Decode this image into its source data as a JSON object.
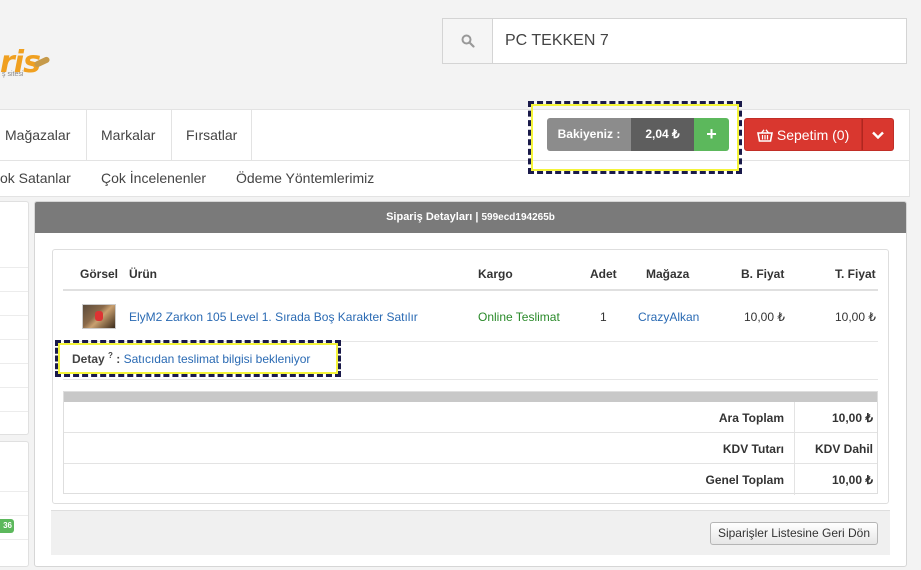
{
  "logo": {
    "text": "ris",
    "subtitle": "ş sitesi"
  },
  "search": {
    "value": "PC TEKKEN 7"
  },
  "nav_primary": [
    "Mağazalar",
    "Markalar",
    "Fırsatlar"
  ],
  "nav_secondary": [
    "ok Satanlar",
    "Çok İncelenenler",
    "Ödeme Yöntemlerimiz"
  ],
  "balance": {
    "label": "Bakiyeniz :",
    "value": "2,04 ₺",
    "add": "+"
  },
  "cart": {
    "label": "Sepetim (0)"
  },
  "side_badge": "36",
  "order": {
    "title": "Sipariş Detayları |",
    "id": "599ecd194265b",
    "columns": {
      "image": "Görsel",
      "product": "Ürün",
      "shipping": "Kargo",
      "qty": "Adet",
      "store": "Mağaza",
      "unit_price": "B. Fiyat",
      "total_price": "T. Fiyat"
    },
    "item": {
      "product": "ElyM2 Zarkon 105 Level 1. Sırada Boş Karakter Satılır",
      "shipping": "Online Teslimat",
      "qty": "1",
      "store": "CrazyAlkan",
      "unit_price": "10,00 ₺",
      "total_price": "10,00 ₺"
    },
    "detail": {
      "label": "Detay",
      "sup": "?",
      "sep": ":",
      "text": "Satıcıdan teslimat bilgisi bekleniyor"
    },
    "summary": [
      {
        "label": "Ara Toplam",
        "value": "10,00 ₺"
      },
      {
        "label": "KDV Tutarı",
        "value": "KDV Dahil"
      },
      {
        "label": "Genel Toplam",
        "value": "10,00 ₺"
      }
    ],
    "back_button": "Siparişler Listesine Geri Dön"
  },
  "colors": {
    "accent_green": "#5cb85c",
    "cart_red": "#d9372f",
    "link_blue": "#2a6ab3",
    "header_gray": "#7a7a7a"
  }
}
